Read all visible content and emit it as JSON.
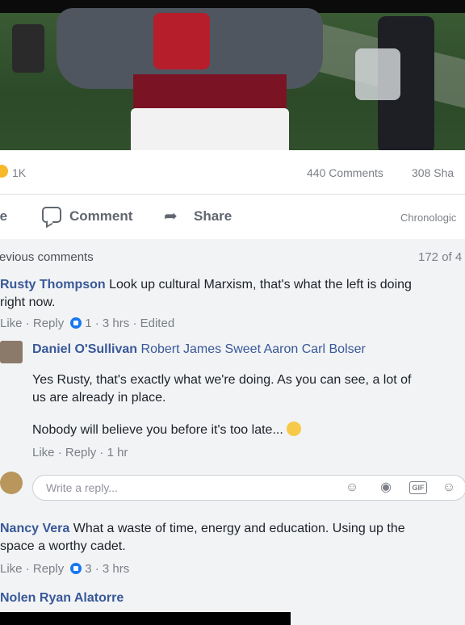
{
  "post": {
    "reactions_count": "1K",
    "comments_count": "440 Comments",
    "shares_count": "308 Sha"
  },
  "actions": {
    "like_label": "te",
    "comment_label": "Comment",
    "share_label": "Share",
    "sort_label": "Chronologic"
  },
  "comments_header": {
    "previous_label": "revious comments",
    "pager": "172 of 4"
  },
  "comments": [
    {
      "author": "Rusty Thompson",
      "text_line1": "Look up cultural Marxism, that's what the left is doing",
      "text_line2": "right now.",
      "like": "Like",
      "reply": "Reply",
      "like_count": "1",
      "time": "3 hrs",
      "edited": "Edited"
    },
    {
      "author": "Nancy Vera",
      "text_line1": "What a waste of time, energy and education. Using up the",
      "text_line2": "space a worthy cadet.",
      "like": "Like",
      "reply": "Reply",
      "like_count": "3",
      "time": "3 hrs"
    },
    {
      "author": "Nolen Ryan Alatorre"
    }
  ],
  "reply": {
    "author": "Daniel O'Sullivan",
    "tags": "Robert James Sweet Aaron Carl Bolser",
    "body1_line1": "Yes Rusty, that's exactly what we're doing. As you can see, a lot of",
    "body1_line2": "us are already in place.",
    "body2": "Nobody will believe you before it's too late...",
    "like": "Like",
    "reply": "Reply",
    "time": "1 hr"
  },
  "composer": {
    "placeholder": "Write a reply..."
  },
  "icons": {
    "emoji": "smile-icon",
    "camera": "camera-icon",
    "gif": "GIF",
    "sticker": "sticker-icon"
  }
}
